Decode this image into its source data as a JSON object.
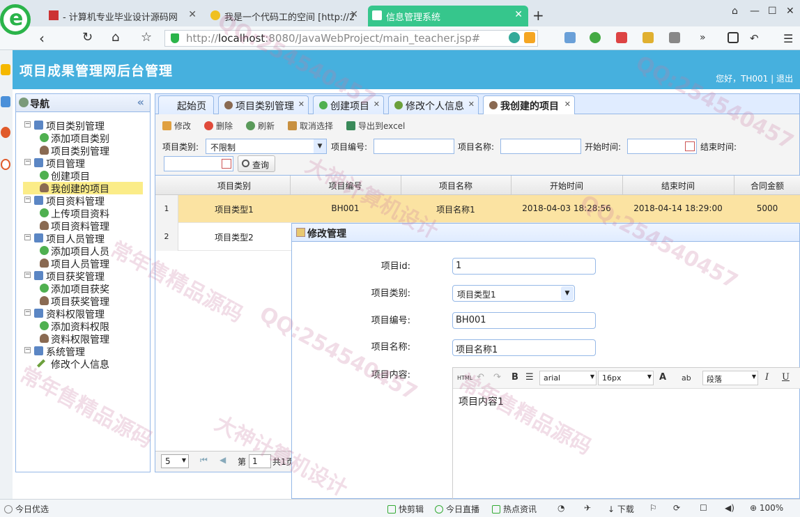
{
  "browser": {
    "tabs": [
      {
        "label": "- 计算机专业毕业设计源码网"
      },
      {
        "label": "我是一个代码工的空间 [http://2"
      },
      {
        "label": "信息管理系统"
      }
    ],
    "url_prefix": "http://",
    "url_host": "localhost",
    "url_rest": ":8080/JavaWebProject/main_teacher.jsp#"
  },
  "app": {
    "title": "项目成果管理网后台管理",
    "user_text": "您好，TH001 | 退出"
  },
  "nav": {
    "title": "导航",
    "collapse_icon": "«",
    "tree": [
      {
        "label": "项目类别管理",
        "level": 0,
        "icon": "folder"
      },
      {
        "label": "添加项目类别",
        "level": 1,
        "icon": "add"
      },
      {
        "label": "项目类别管理",
        "level": 1,
        "icon": "person"
      },
      {
        "label": "项目管理",
        "level": 0,
        "icon": "folder"
      },
      {
        "label": "创建项目",
        "level": 1,
        "icon": "add"
      },
      {
        "label": "我创建的项目",
        "level": 1,
        "icon": "person",
        "selected": true
      },
      {
        "label": "项目资料管理",
        "level": 0,
        "icon": "folder"
      },
      {
        "label": "上传项目资料",
        "level": 1,
        "icon": "add"
      },
      {
        "label": "项目资料管理",
        "level": 1,
        "icon": "person"
      },
      {
        "label": "项目人员管理",
        "level": 0,
        "icon": "folder"
      },
      {
        "label": "添加项目人员",
        "level": 1,
        "icon": "add"
      },
      {
        "label": "项目人员管理",
        "level": 1,
        "icon": "person"
      },
      {
        "label": "项目获奖管理",
        "level": 0,
        "icon": "folder"
      },
      {
        "label": "添加项目获奖",
        "level": 1,
        "icon": "add"
      },
      {
        "label": "项目获奖管理",
        "level": 1,
        "icon": "person"
      },
      {
        "label": "资料权限管理",
        "level": 0,
        "icon": "folder"
      },
      {
        "label": "添加资料权限",
        "level": 1,
        "icon": "add"
      },
      {
        "label": "资料权限管理",
        "level": 1,
        "icon": "person"
      },
      {
        "label": "系统管理",
        "level": 0,
        "icon": "folder"
      },
      {
        "label": "修改个人信息",
        "level": 1,
        "icon": "pencil"
      }
    ]
  },
  "content_tabs": [
    {
      "label": "起始页"
    },
    {
      "label": "项目类别管理"
    },
    {
      "label": "创建项目"
    },
    {
      "label": "修改个人信息"
    },
    {
      "label": "我创建的项目",
      "active": true
    }
  ],
  "toolbar": {
    "edit": "修改",
    "delete": "删除",
    "refresh": "刷新",
    "cancel_select": "取消选择",
    "export": "导出到excel"
  },
  "filters": {
    "category_label": "项目类别:",
    "category_value": "不限制",
    "number_label": "项目编号:",
    "name_label": "项目名称:",
    "start_label": "开始时间:",
    "end_label": "结束时间:",
    "search_label": "查询"
  },
  "grid": {
    "columns": [
      "项目类别",
      "项目编号",
      "项目名称",
      "开始时间",
      "结束时间",
      "合同金额"
    ],
    "rows": [
      {
        "num": "1",
        "cells": [
          "项目类型1",
          "BH001",
          "项目名称1",
          "2018-04-03 18:28:56",
          "2018-04-14 18:29:00",
          "5000"
        ]
      },
      {
        "num": "2",
        "cells": [
          "项目类型2",
          "",
          "",
          "",
          "",
          ""
        ]
      }
    ],
    "page_size": "5",
    "page_label_pre": "第",
    "page_value": "1",
    "page_label_post": "共1页"
  },
  "dialog": {
    "title": "修改管理",
    "id_label": "项目id:",
    "id_value": "1",
    "category_label": "项目类别:",
    "category_value": "项目类型1",
    "number_label": "项目编号:",
    "number_value": "BH001",
    "name_label": "项目名称:",
    "name_value": "项目名称1",
    "content_label": "项目内容:",
    "content_value": "项目内容1",
    "editor": {
      "html": "HTML",
      "bold": "B",
      "font": "arial",
      "size": "16px",
      "color_a": "A",
      "paragraph": "段落",
      "italic": "I",
      "underline": "U"
    }
  },
  "statusbar": {
    "left": "今日优选",
    "items": [
      "快剪辑",
      "今日直播",
      "热点资讯",
      "下载",
      "100%"
    ]
  },
  "watermarks": [
    "QQ:254540457",
    "大神计算机设计",
    "常年售精品源码"
  ]
}
